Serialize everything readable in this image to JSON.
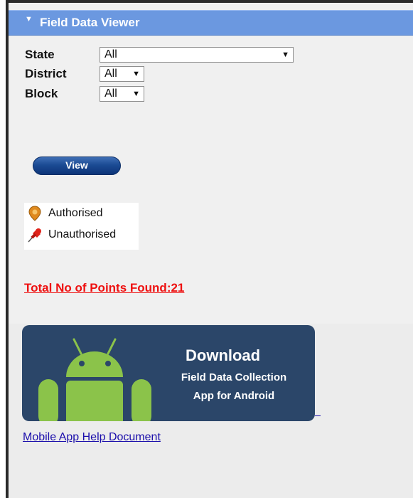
{
  "panel": {
    "title": "Field Data Viewer",
    "collapse_icon": "triangle-down-icon"
  },
  "filters": {
    "state": {
      "label": "State",
      "value": "All"
    },
    "district": {
      "label": "District",
      "value": "All"
    },
    "block": {
      "label": "Block",
      "value": "All"
    }
  },
  "view_button": {
    "label": "View"
  },
  "legend": {
    "authorised": {
      "label": "Authorised",
      "icon": "orange-map-pin-icon",
      "color": "#e08a1e"
    },
    "unauthorised": {
      "label": "Unauthorised",
      "icon": "red-pushpin-icon",
      "color": "#e0241b"
    }
  },
  "summary": {
    "total_points": "Total No of Points Found:21",
    "color": "#ee1111"
  },
  "banner": {
    "heading": "Download",
    "line2": "Field Data Collection",
    "line3": "App for Android",
    "icon": "android-robot-icon",
    "background": "#2b4669",
    "android_color": "#8bc34a"
  },
  "help_link": {
    "label": "Mobile App Help Document "
  }
}
